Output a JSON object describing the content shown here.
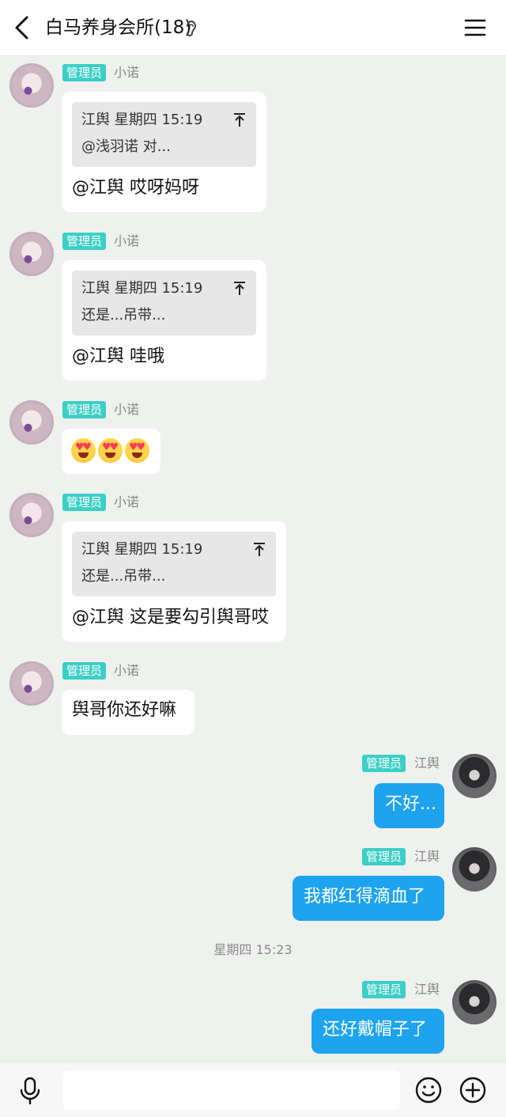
{
  "header": {
    "title": "白马养身会所(18)"
  },
  "messages": [
    {
      "side": "left",
      "badge": "管理员",
      "sender": "小诺",
      "quote": {
        "meta": "江舆 星期四 15:19",
        "text": "@浅羽诺 对..."
      },
      "text": "@江舆 哎呀妈呀"
    },
    {
      "side": "left",
      "badge": "管理员",
      "sender": "小诺",
      "quote": {
        "meta": "江舆 星期四 15:19",
        "text": "还是...吊带..."
      },
      "text": "@江舆 哇哦"
    },
    {
      "side": "left",
      "badge": "管理员",
      "sender": "小诺",
      "emoji": [
        "star-struck-emoji",
        "star-struck-emoji",
        "star-struck-emoji"
      ]
    },
    {
      "side": "left",
      "badge": "管理员",
      "sender": "小诺",
      "quote": {
        "meta": "江舆 星期四 15:19",
        "text": "还是...吊带..."
      },
      "text": "@江舆 这是要勾引舆哥哎"
    },
    {
      "side": "left",
      "badge": "管理员",
      "sender": "小诺",
      "text": "舆哥你还好嘛"
    },
    {
      "side": "right",
      "badge": "管理员",
      "sender": "江舆",
      "text": "不好..."
    },
    {
      "side": "right",
      "badge": "管理员",
      "sender": "江舆",
      "text": "我都红得滴血了"
    },
    {
      "side": "right",
      "badge": "管理员",
      "sender": "江舆",
      "text": "还好戴帽子了"
    }
  ],
  "time_separator": "星期四 15:23",
  "colors": {
    "background": "#eef1ee",
    "badge": "#3ccfc6",
    "my_bubble": "#1ea3ef"
  },
  "icons": [
    "back-arrow-icon",
    "ear-icon",
    "menu-icon",
    "pin-icon",
    "microphone-icon",
    "emoji-icon",
    "plus-icon"
  ]
}
